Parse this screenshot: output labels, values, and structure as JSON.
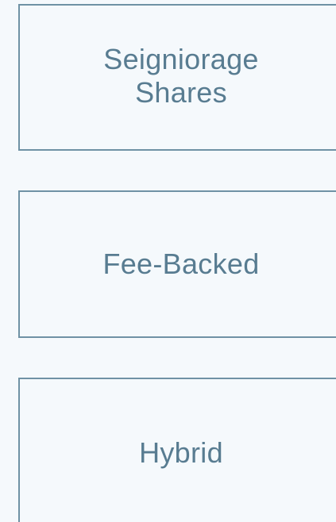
{
  "options": [
    {
      "label_line1": "Seigniorage",
      "label_line2": "Shares"
    },
    {
      "label": "Fee-Backed"
    },
    {
      "label": "Hybrid"
    }
  ],
  "colors": {
    "background": "#f5f9fc",
    "border": "#6f92a5",
    "text": "#587c91"
  }
}
